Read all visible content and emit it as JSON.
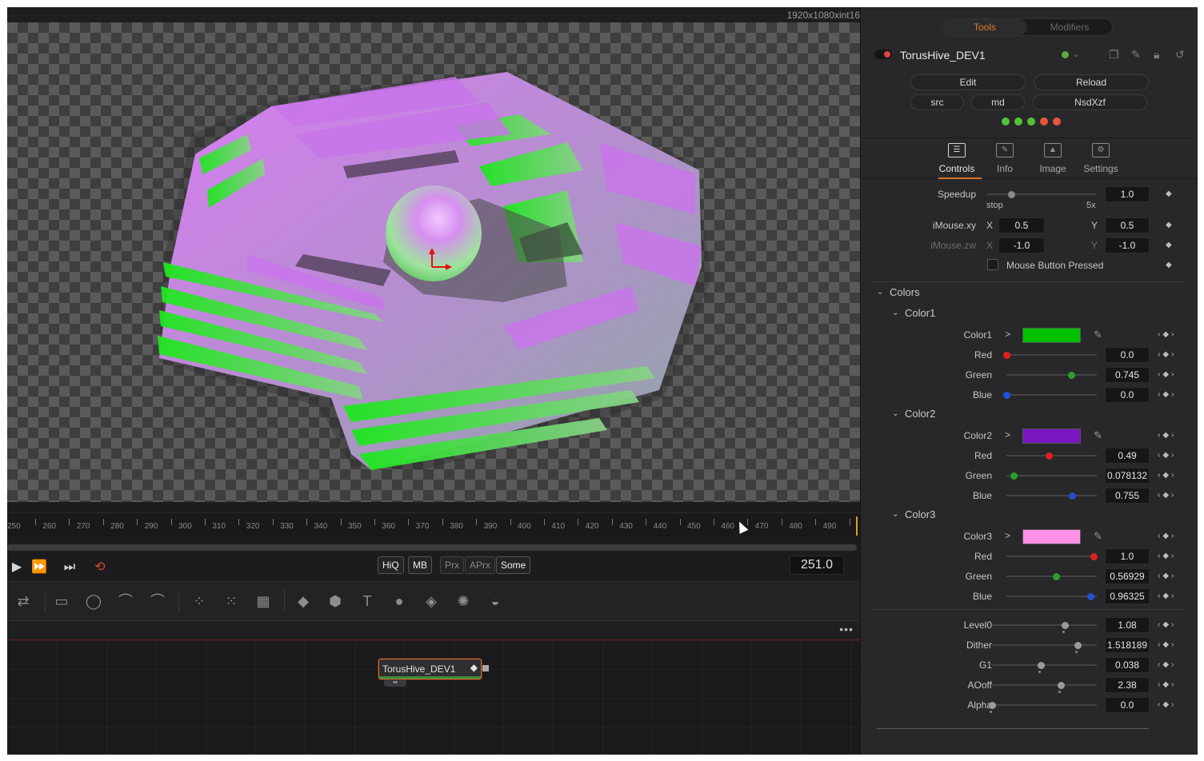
{
  "viewer": {
    "resolution": "1920x1080xint16"
  },
  "timeline": {
    "ticks": [
      "250",
      "260",
      "270",
      "280",
      "290",
      "300",
      "310",
      "320",
      "330",
      "340",
      "350",
      "360",
      "370",
      "380",
      "390",
      "400",
      "410",
      "420",
      "430",
      "440",
      "450",
      "460",
      "470",
      "480",
      "490"
    ],
    "current_frame": "251.0"
  },
  "transport": {
    "quality_buttons": [
      {
        "label": "HiQ",
        "on": true
      },
      {
        "label": "MB",
        "on": true
      },
      {
        "label": "Prx",
        "on": false
      },
      {
        "label": "APrx",
        "on": false
      },
      {
        "label": "Some",
        "on": true
      }
    ]
  },
  "node_editor": {
    "more": "•••",
    "node_label": "TorusHive_DEV1"
  },
  "inspector": {
    "tabs": {
      "tools": "Tools",
      "modifiers": "Modifiers"
    },
    "tool_name": "TorusHive_DEV1",
    "buttons": {
      "edit": "Edit",
      "reload": "Reload",
      "src": "src",
      "md": "md",
      "nsdxzf": "NsdXzf"
    },
    "status_dots": [
      "#52c23a",
      "#52c23a",
      "#52c23a",
      "#e8553c",
      "#e8553c"
    ],
    "sub_tabs": [
      "Controls",
      "Info",
      "Image",
      "Settings"
    ],
    "speedup": {
      "label": "Speedup",
      "value": "1.0",
      "min_label": "stop",
      "max_label": "5x",
      "level": 0.22
    },
    "imouse_xy": {
      "label": "iMouse.xy",
      "x_label": "X",
      "x": "0.5",
      "y_label": "Y",
      "y": "0.5"
    },
    "imouse_zw": {
      "label": "iMouse.zw",
      "x_label": "X",
      "x": "-1.0",
      "y_label": "Y",
      "y": "-1.0"
    },
    "mouse_button": {
      "label": "Mouse Button Pressed",
      "checked": false
    },
    "colors_group": "Colors",
    "color1": {
      "group": "Color1",
      "label": "Color1",
      "swatch": "#00c000",
      "red": {
        "label": "Red",
        "value": "0.0",
        "level": 0.0,
        "knob": "#e02020"
      },
      "green": {
        "label": "Green",
        "value": "0.745",
        "level": 0.745,
        "knob": "#2aa02a"
      },
      "blue": {
        "label": "Blue",
        "value": "0.0",
        "level": 0.0,
        "knob": "#2050d0"
      }
    },
    "color2": {
      "group": "Color2",
      "label": "Color2",
      "swatch": "#7a16c0",
      "red": {
        "label": "Red",
        "value": "0.49",
        "level": 0.49,
        "knob": "#e02020"
      },
      "green": {
        "label": "Green",
        "value": "0.078132",
        "level": 0.078,
        "knob": "#2aa02a"
      },
      "blue": {
        "label": "Blue",
        "value": "0.755",
        "level": 0.755,
        "knob": "#2050d0"
      }
    },
    "color3": {
      "group": "Color3",
      "label": "Color3",
      "swatch": "#ff90e8",
      "red": {
        "label": "Red",
        "value": "1.0",
        "level": 1.0,
        "knob": "#e02020"
      },
      "green": {
        "label": "Green",
        "value": "0.56929",
        "level": 0.569,
        "knob": "#2aa02a"
      },
      "blue": {
        "label": "Blue",
        "value": "0.96325",
        "level": 0.963,
        "knob": "#2050d0"
      }
    },
    "params": [
      {
        "label": "Level0",
        "value": "1.08",
        "level": 0.72
      },
      {
        "label": "Dither",
        "value": "1.518189",
        "level": 0.84
      },
      {
        "label": "G1",
        "value": "0.038",
        "level": 0.48
      },
      {
        "label": "AOoff",
        "value": "2.38",
        "level": 0.68
      },
      {
        "label": "Alpha",
        "value": "0.0",
        "level": 0.0
      }
    ]
  }
}
